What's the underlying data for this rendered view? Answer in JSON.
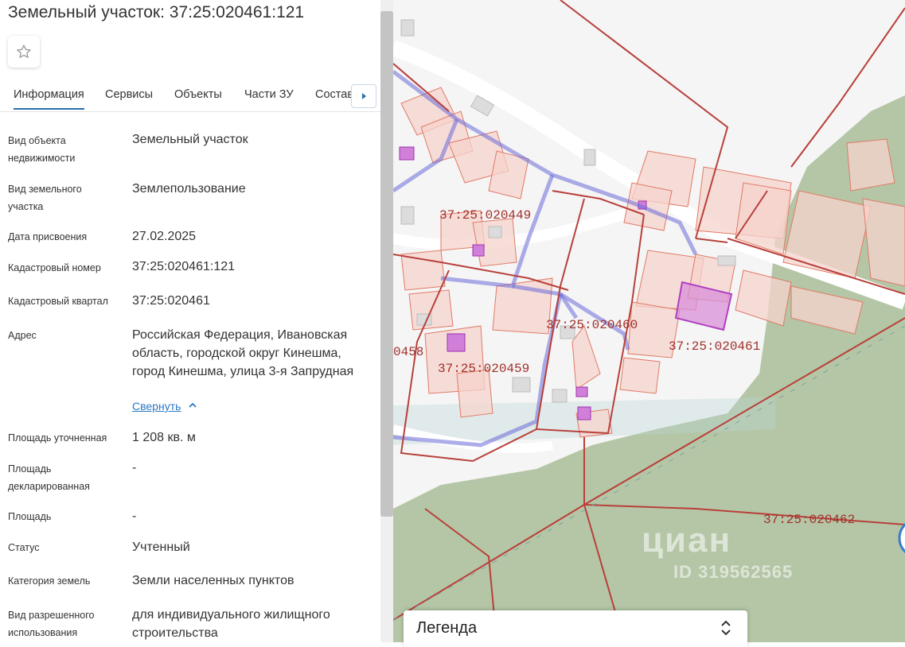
{
  "title": "Земельный участок: 37:25:020461:121",
  "tabs": [
    "Информация",
    "Сервисы",
    "Объекты",
    "Части ЗУ",
    "Состав"
  ],
  "fields": [
    {
      "label": "Вид объекта недвижимости",
      "value": "Земельный участок"
    },
    {
      "label": "Вид земельного участка",
      "value": "Землепользование"
    },
    {
      "label": "Дата присвоения",
      "value": "27.02.2025"
    },
    {
      "label": "Кадастровый номер",
      "value": "37:25:020461:121"
    },
    {
      "label": "Кадастровый квартал",
      "value": "37:25:020461"
    },
    {
      "label": "Адрес",
      "value": "Российская Федерация, Ивановская область, городской округ Кинешма, город Кинешма, улица 3-я Запрудная"
    },
    {
      "label": "Площадь уточненная",
      "value": "1 208 кв. м"
    },
    {
      "label": "Площадь декларированная",
      "value": "-"
    },
    {
      "label": "Площадь",
      "value": "-"
    },
    {
      "label": "Статус",
      "value": "Учтенный"
    },
    {
      "label": "Категория земель",
      "value": "Земли населенных пунктов"
    },
    {
      "label": "Вид разрешенного использования",
      "value": "для индивидуального жилищного строительства"
    }
  ],
  "collapse_label": "Свернуть",
  "map": {
    "quarters": [
      "37:25:020449",
      "37:25:020460",
      "0458",
      "37:25:020459",
      "37:25:020461",
      "37:25:020462"
    ],
    "colors": {
      "boundary": "#b8403a",
      "parcel_fill": "#f6d3cc",
      "parcel_stroke": "#e07a66",
      "forest": "#a8bd98",
      "selected": "#b040c0",
      "utility": "#6a6ad8"
    }
  },
  "legend_title": "Легенда",
  "watermark": "циан",
  "watermark_id": "ID 319562565",
  "icons": {
    "favorite": "star-icon",
    "tabs_next": "arrow-right-icon",
    "collapse": "chevron-up-icon",
    "legend_toggle": "chevron-updown-icon"
  }
}
